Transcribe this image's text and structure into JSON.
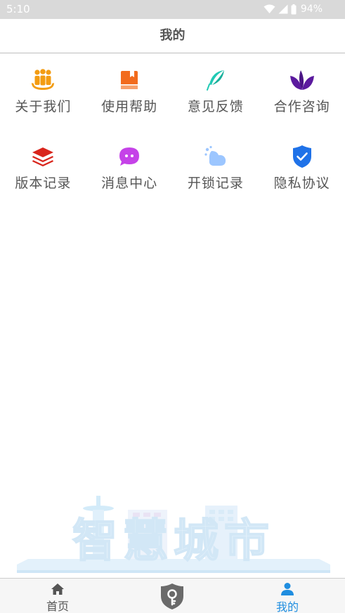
{
  "status_bar": {
    "time": "5:10",
    "battery": "94%",
    "icons": [
      "wifi-icon",
      "signal-icon",
      "battery-icon"
    ]
  },
  "header": {
    "title": "我的"
  },
  "menu": [
    {
      "label": "关于我们",
      "icon": "people-group-icon",
      "color": "#f39c12"
    },
    {
      "label": "使用帮助",
      "icon": "book-icon",
      "color": "#f26b1d"
    },
    {
      "label": "意见反馈",
      "icon": "feather-icon",
      "color": "#20c9b4"
    },
    {
      "label": "合作咨询",
      "icon": "leaf-icon",
      "color": "#5b1a9e"
    },
    {
      "label": "版本记录",
      "icon": "layers-icon",
      "color": "#d9251c"
    },
    {
      "label": "消息中心",
      "icon": "chat-bubble-icon",
      "color": "#c542e8"
    },
    {
      "label": "开锁记录",
      "icon": "cloud-icon",
      "color": "#9cc6ff"
    },
    {
      "label": "隐私协议",
      "icon": "shield-check-icon",
      "color": "#1f72e8"
    }
  ],
  "illustration": {
    "text": "智慧城市",
    "icon": "city-skyline-illustration"
  },
  "tabbar": {
    "items": [
      {
        "label": "首页",
        "icon": "home-icon"
      },
      {
        "label": "",
        "icon": "key-shield-icon"
      },
      {
        "label": "我的",
        "icon": "person-icon",
        "active": true
      }
    ],
    "active_color": "#1f8ee0"
  }
}
